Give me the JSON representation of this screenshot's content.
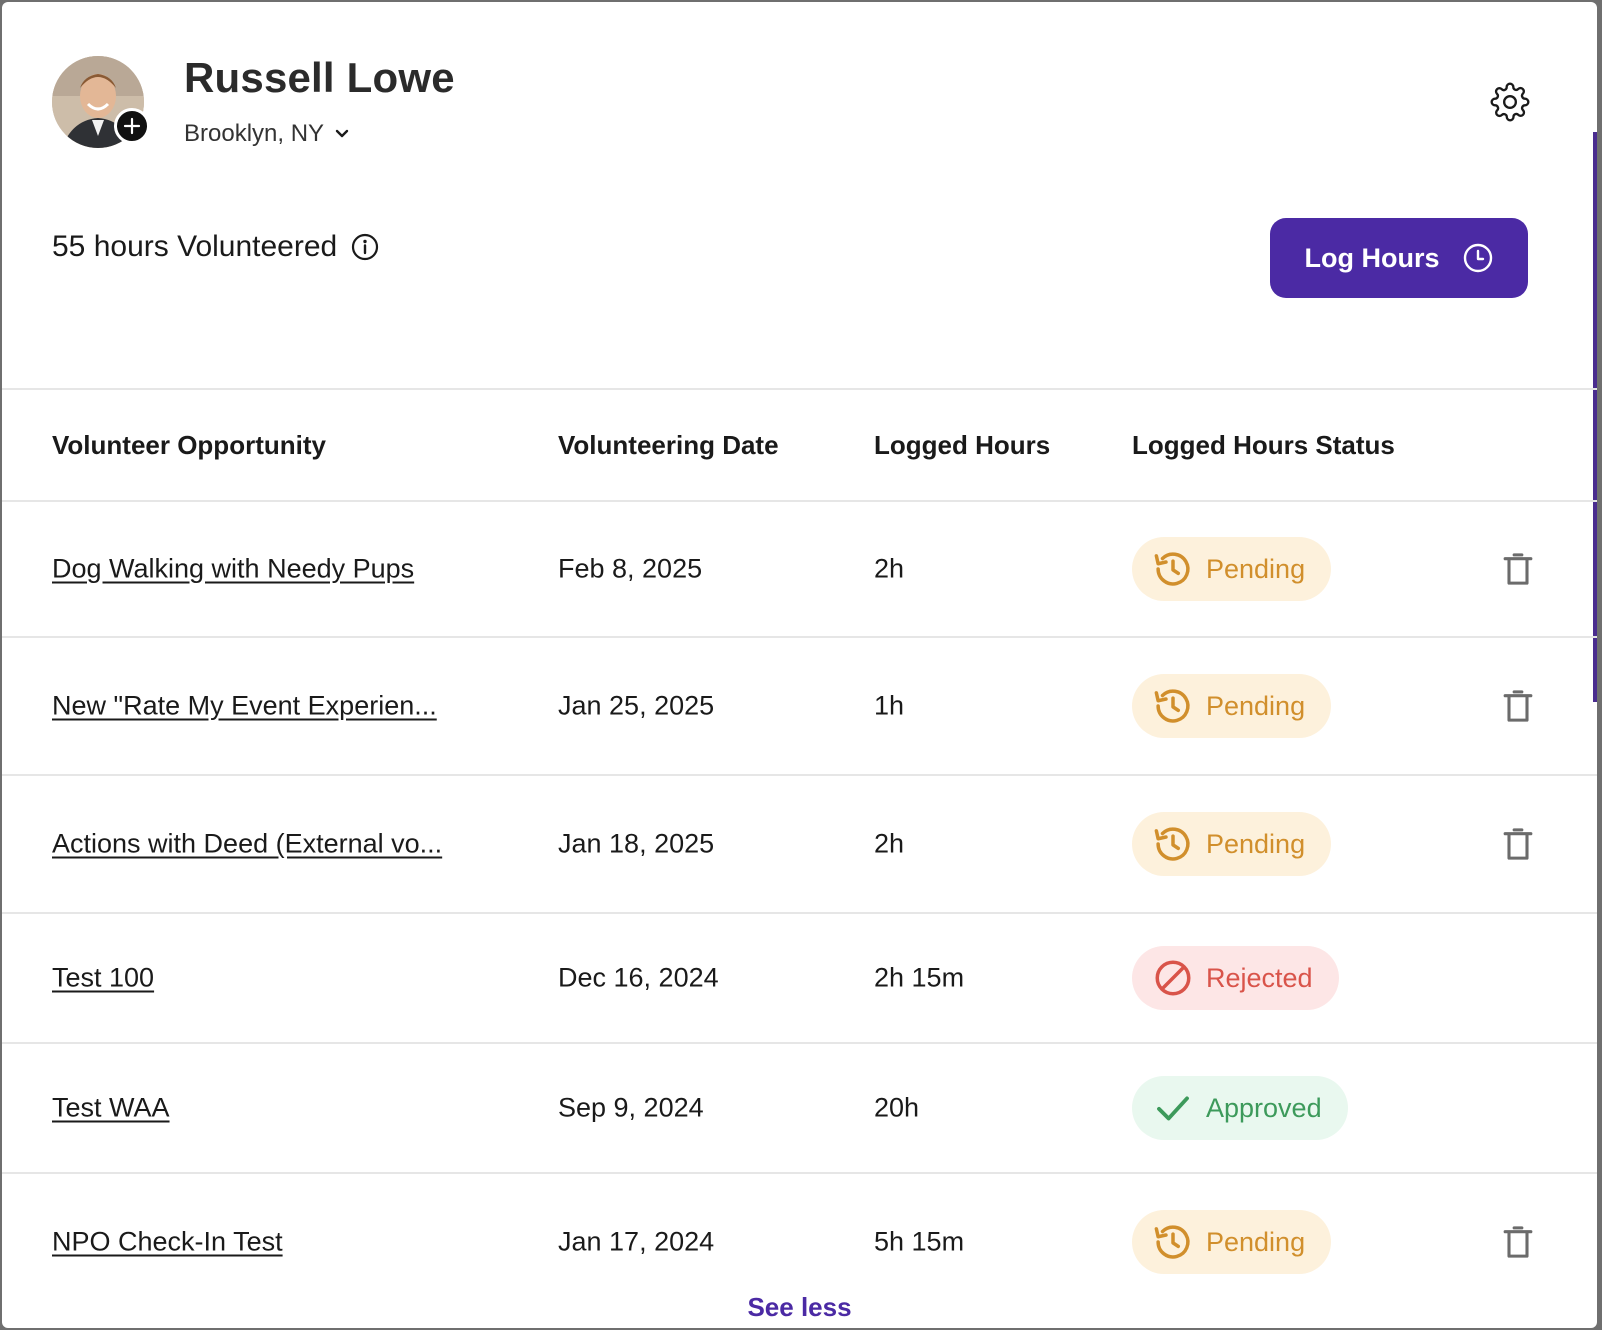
{
  "profile": {
    "name": "Russell Lowe",
    "location": "Brooklyn, NY"
  },
  "summary": {
    "hours_text": "55 hours Volunteered"
  },
  "actions": {
    "log_hours_label": "Log Hours"
  },
  "table": {
    "headers": {
      "opportunity": "Volunteer Opportunity",
      "date": "Volunteering Date",
      "hours": "Logged Hours",
      "status": "Logged Hours Status"
    },
    "rows": [
      {
        "opportunity": "Dog Walking with Needy Pups",
        "date": "Feb 8, 2025",
        "hours": "2h",
        "status": "Pending"
      },
      {
        "opportunity": "New \"Rate My Event Experien...",
        "date": "Jan 25, 2025",
        "hours": "1h",
        "status": "Pending"
      },
      {
        "opportunity": "Actions with Deed (External vo...",
        "date": "Jan 18, 2025",
        "hours": "2h",
        "status": "Pending"
      },
      {
        "opportunity": "Test 100",
        "date": "Dec 16, 2024",
        "hours": "2h 15m",
        "status": "Rejected"
      },
      {
        "opportunity": "Test WAA",
        "date": "Sep 9, 2024",
        "hours": "20h",
        "status": "Approved"
      },
      {
        "opportunity": "NPO Check-In Test",
        "date": "Jan 17, 2024",
        "hours": "5h 15m",
        "status": "Pending"
      }
    ]
  },
  "footer": {
    "see_less_label": "See less"
  },
  "icons": {
    "settings": "gear-icon",
    "info": "info-icon",
    "clock": "clock-icon",
    "pending": "history-icon",
    "rejected": "ban-icon",
    "approved": "check-icon",
    "delete": "trash-icon",
    "add": "plus-icon",
    "dropdown": "chevron-down-icon"
  },
  "colors": {
    "brand": "#4b2aa4",
    "pending_text": "#d18f2c",
    "pending_bg": "#fdf1dc",
    "rejected_text": "#d9544a",
    "rejected_bg": "#fde6e6",
    "approved_text": "#3d9a5b",
    "approved_bg": "#e9f8ef"
  }
}
